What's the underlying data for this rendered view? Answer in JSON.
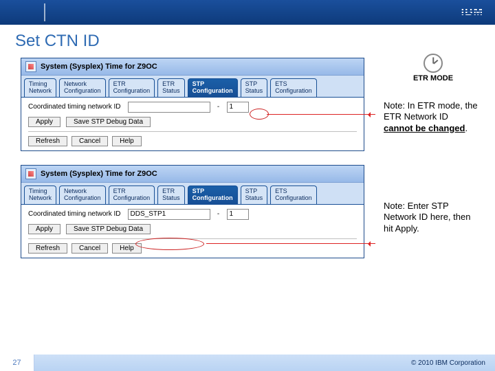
{
  "slide": {
    "title": "Set CTN ID",
    "page_number": "27",
    "copyright": "© 2010 IBM Corporation"
  },
  "tabs": {
    "t1": "Timing\nNetwork",
    "t2": "Network\nConfiguration",
    "t3": "ETR\nConfiguration",
    "t4": "ETR\nStatus",
    "t5": "STP\nConfiguration",
    "t6": "STP\nStatus",
    "t7": "ETS\nConfiguration"
  },
  "panel1": {
    "title": "System (Sysplex) Time for Z9OC",
    "field_label": "Coordinated timing network ID",
    "field_value_a": "",
    "field_sep": "-",
    "field_value_b": "1",
    "apply": "Apply",
    "save_debug": "Save STP Debug Data",
    "refresh": "Refresh",
    "cancel": "Cancel",
    "help": "Help"
  },
  "panel2": {
    "title": "System (Sysplex) Time for Z9OC",
    "field_label": "Coordinated timing network ID",
    "field_value_a": "DDS_STP1",
    "field_sep": "-",
    "field_value_b": "1",
    "apply": "Apply",
    "save_debug": "Save STP Debug Data",
    "refresh": "Refresh",
    "cancel": "Cancel",
    "help": "Help"
  },
  "notes": {
    "head": "ETR MODE",
    "n1a": "Note: In ETR mode, the ETR Network ID ",
    "n1b": "cannot be changed",
    "n1c": ".",
    "n2": "Note: Enter STP Network ID here, then hit Apply."
  }
}
